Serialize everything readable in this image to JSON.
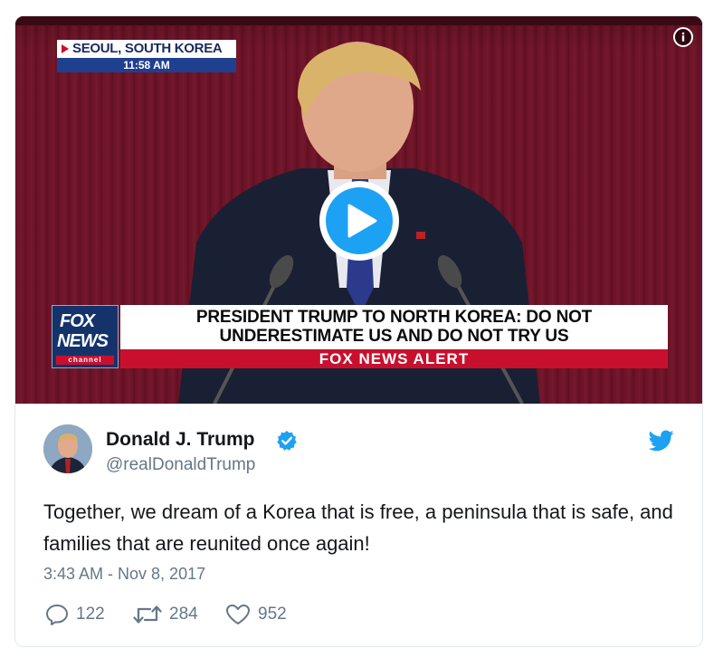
{
  "video": {
    "dateline_location": "SEOUL, SOUTH KOREA",
    "dateline_time": "11:58 AM",
    "network_logo_line1": "FOX",
    "network_logo_line2": "NEWS",
    "network_logo_line3": "channel",
    "headline_line1": "PRESIDENT TRUMP TO NORTH KOREA: DO NOT",
    "headline_line2": "UNDERESTIMATE US AND DO NOT TRY US",
    "alert": "FOX NEWS ALERT"
  },
  "author": {
    "name": "Donald J. Trump",
    "handle": "@realDonaldTrump",
    "verified": true
  },
  "tweet": {
    "text": "Together, we dream of a Korea that is free, a peninsula that is safe, and families that are reunited once again!",
    "timestamp": "3:43 AM - Nov 8, 2017"
  },
  "actions": {
    "replies": "122",
    "retweets": "284",
    "likes": "952"
  },
  "colors": {
    "accent": "#1da1f2",
    "muted": "#657786",
    "text": "#14171a",
    "border": "#e1e8ed"
  },
  "icons": [
    "info-icon",
    "play-icon",
    "verified-badge-icon",
    "twitter-bird-icon",
    "reply-icon",
    "retweet-icon",
    "like-icon"
  ]
}
